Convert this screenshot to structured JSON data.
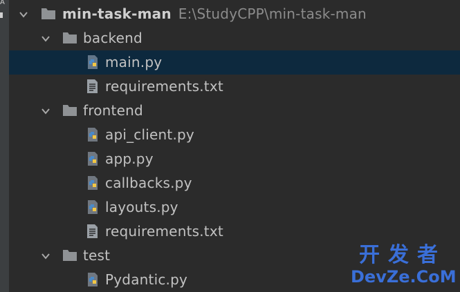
{
  "project": {
    "name": "min-task-man",
    "path": "E:\\StudyCPP\\min-task-man"
  },
  "tree": {
    "backend": {
      "label": "backend",
      "files": [
        "main.py",
        "requirements.txt"
      ]
    },
    "frontend": {
      "label": "frontend",
      "files": [
        "api_client.py",
        "app.py",
        "callbacks.py",
        "layouts.py",
        "requirements.txt"
      ]
    },
    "test": {
      "label": "test",
      "files": [
        "Pydantic.py"
      ]
    }
  },
  "selected_file": "main.py",
  "watermark": {
    "top": "开发者",
    "bottom": "DevZe.CoM"
  },
  "colors": {
    "background": "#2b2b2b",
    "selection": "#0d293e",
    "folder": "#8f9295",
    "python_blue": "#4a8ac9",
    "python_yellow": "#f2c744",
    "watermark": "#3a6fd8"
  }
}
